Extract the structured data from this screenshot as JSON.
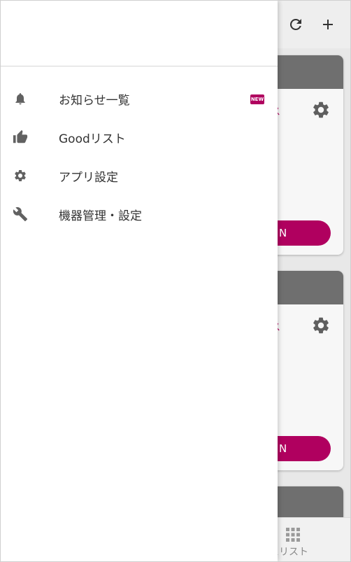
{
  "toolbar": {
    "refresh_icon": "refresh-icon",
    "add_icon": "plus-icon"
  },
  "cards": [
    {
      "service_text": "ビス",
      "button_text": "N"
    },
    {
      "service_text": "ビス",
      "button_text": "N"
    },
    {
      "service_text": "",
      "button_text": ""
    }
  ],
  "bottom_nav": {
    "label": "ビスリスト",
    "icon": "grid-icon"
  },
  "drawer": {
    "items": [
      {
        "label": "お知らせ一覧",
        "icon": "bell-icon",
        "badge": "NEW"
      },
      {
        "label": "Goodリスト",
        "icon": "thumbs-up-icon"
      },
      {
        "label": "アプリ設定",
        "icon": "gear-icon"
      },
      {
        "label": "機器管理・設定",
        "icon": "wrench-icon"
      }
    ]
  },
  "colors": {
    "accent": "#b0005f",
    "card_header": "#6f6f6f",
    "icon": "#616161"
  }
}
